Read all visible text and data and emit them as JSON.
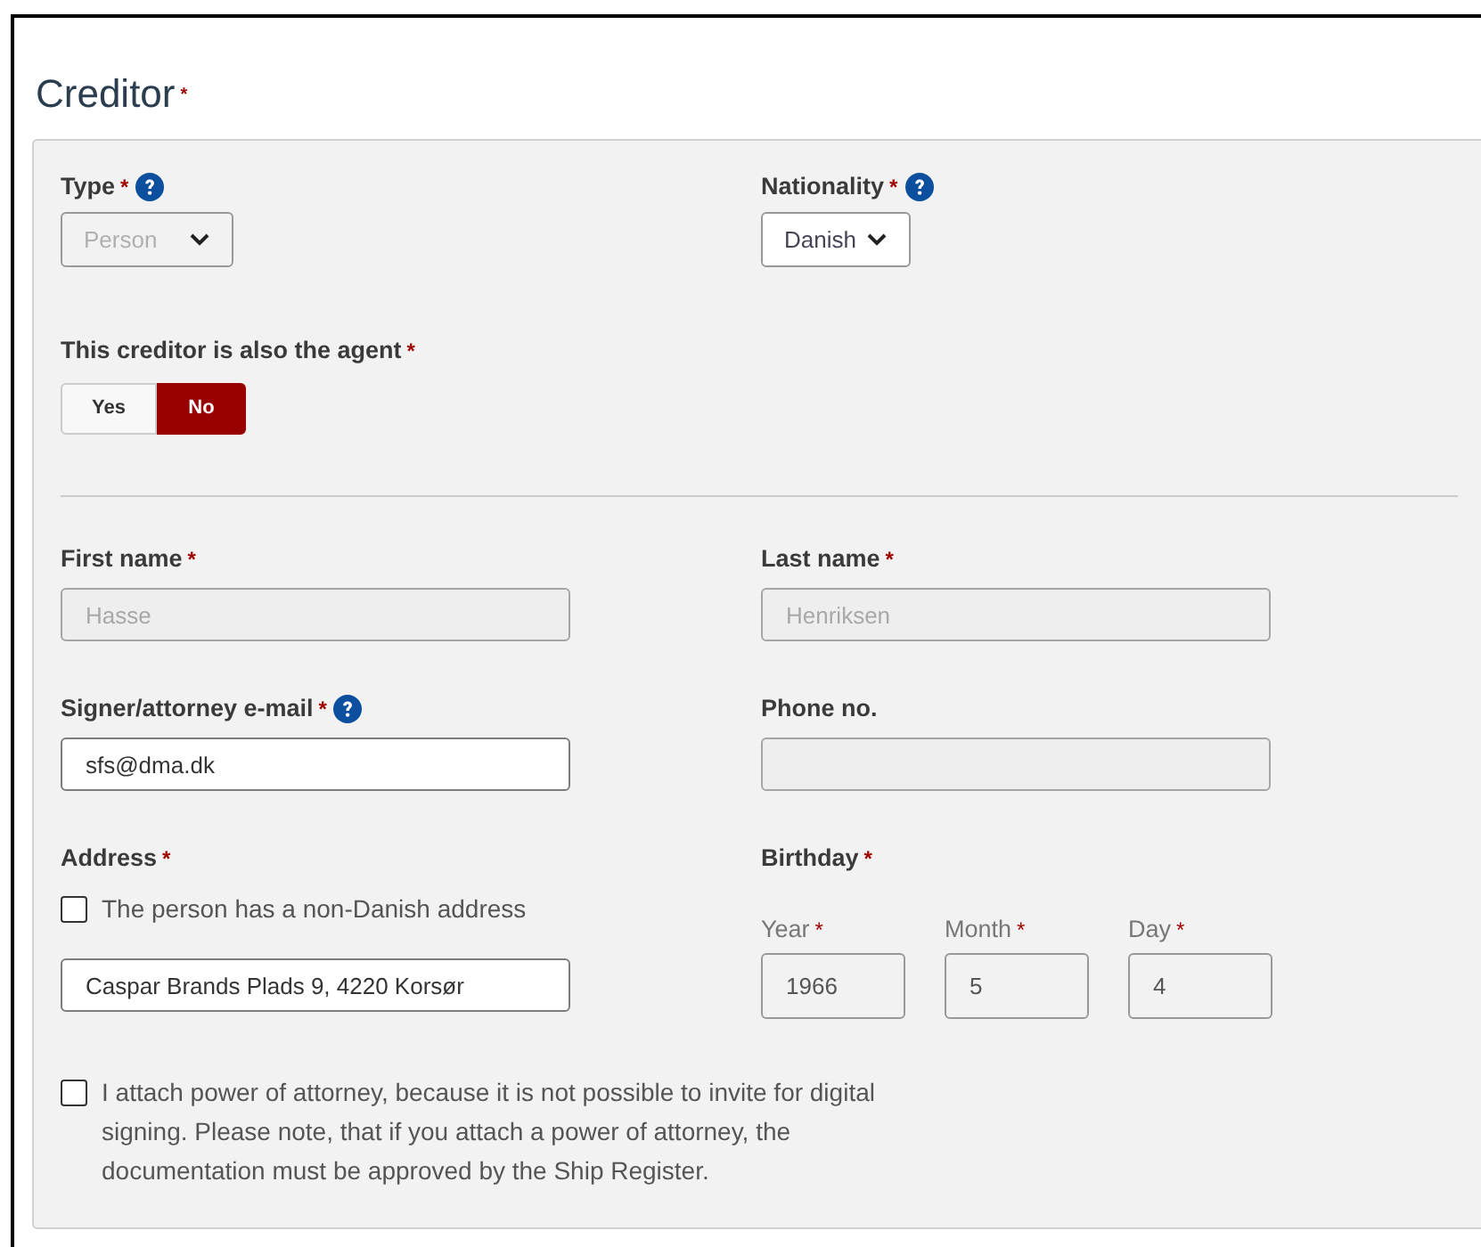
{
  "title": {
    "text": "Creditor",
    "required_mark": "*"
  },
  "top_fields": [
    {
      "label": "Type",
      "required_mark": "*",
      "help": true,
      "value": "Person",
      "disabled": true
    },
    {
      "label": "Nationality",
      "required_mark": "*",
      "help": true,
      "value": "Danish",
      "disabled": false
    }
  ],
  "agent_toggle": {
    "label": "This creditor is also the agent",
    "required_mark": "*",
    "options": [
      {
        "label": "Yes",
        "selected": false
      },
      {
        "label": "No",
        "selected": true
      }
    ]
  },
  "field_rows": [
    [
      {
        "label": "First name",
        "required_mark": "*",
        "value": "Hasse",
        "disabled": true
      },
      {
        "label": "Last name",
        "required_mark": "*",
        "value": "Henriksen",
        "disabled": true
      }
    ],
    [
      {
        "label": "Signer/attorney e-mail",
        "required_mark": "*",
        "help": true,
        "value": "sfs@dma.dk",
        "disabled": false
      },
      {
        "label": "Phone no.",
        "disabled": true
      }
    ]
  ],
  "address": {
    "label": "Address",
    "required_mark": "*",
    "checkbox": {
      "label": "The person has a non-Danish address",
      "checked": false
    },
    "value": "Caspar Brands Plads 9, 4220 Korsør",
    "disabled": false
  },
  "birthday": {
    "label": "Birthday",
    "required_mark": "*",
    "parts": [
      {
        "label": "Year",
        "required_mark": "*",
        "value": "1966",
        "readonly": true
      },
      {
        "label": "Month",
        "required_mark": "*",
        "value": "5",
        "readonly": true
      },
      {
        "label": "Day",
        "required_mark": "*",
        "value": "4",
        "readonly": true
      }
    ]
  },
  "attorney_checkbox": {
    "label": "I attach power of attorney, because it is not possible to invite for digital signing. Please note, that if you attach a power of attorney, the documentation must be approved by the Ship Register.",
    "checked": false
  }
}
